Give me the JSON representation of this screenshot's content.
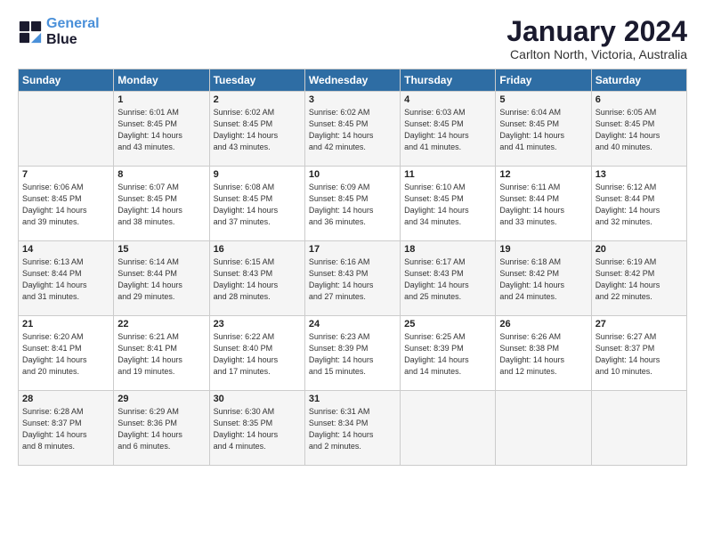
{
  "logo": {
    "line1": "General",
    "line2": "Blue"
  },
  "title": "January 2024",
  "subtitle": "Carlton North, Victoria, Australia",
  "days_header": [
    "Sunday",
    "Monday",
    "Tuesday",
    "Wednesday",
    "Thursday",
    "Friday",
    "Saturday"
  ],
  "weeks": [
    [
      {
        "day": "",
        "info": ""
      },
      {
        "day": "1",
        "info": "Sunrise: 6:01 AM\nSunset: 8:45 PM\nDaylight: 14 hours\nand 43 minutes."
      },
      {
        "day": "2",
        "info": "Sunrise: 6:02 AM\nSunset: 8:45 PM\nDaylight: 14 hours\nand 43 minutes."
      },
      {
        "day": "3",
        "info": "Sunrise: 6:02 AM\nSunset: 8:45 PM\nDaylight: 14 hours\nand 42 minutes."
      },
      {
        "day": "4",
        "info": "Sunrise: 6:03 AM\nSunset: 8:45 PM\nDaylight: 14 hours\nand 41 minutes."
      },
      {
        "day": "5",
        "info": "Sunrise: 6:04 AM\nSunset: 8:45 PM\nDaylight: 14 hours\nand 41 minutes."
      },
      {
        "day": "6",
        "info": "Sunrise: 6:05 AM\nSunset: 8:45 PM\nDaylight: 14 hours\nand 40 minutes."
      }
    ],
    [
      {
        "day": "7",
        "info": "Sunrise: 6:06 AM\nSunset: 8:45 PM\nDaylight: 14 hours\nand 39 minutes."
      },
      {
        "day": "8",
        "info": "Sunrise: 6:07 AM\nSunset: 8:45 PM\nDaylight: 14 hours\nand 38 minutes."
      },
      {
        "day": "9",
        "info": "Sunrise: 6:08 AM\nSunset: 8:45 PM\nDaylight: 14 hours\nand 37 minutes."
      },
      {
        "day": "10",
        "info": "Sunrise: 6:09 AM\nSunset: 8:45 PM\nDaylight: 14 hours\nand 36 minutes."
      },
      {
        "day": "11",
        "info": "Sunrise: 6:10 AM\nSunset: 8:45 PM\nDaylight: 14 hours\nand 34 minutes."
      },
      {
        "day": "12",
        "info": "Sunrise: 6:11 AM\nSunset: 8:44 PM\nDaylight: 14 hours\nand 33 minutes."
      },
      {
        "day": "13",
        "info": "Sunrise: 6:12 AM\nSunset: 8:44 PM\nDaylight: 14 hours\nand 32 minutes."
      }
    ],
    [
      {
        "day": "14",
        "info": "Sunrise: 6:13 AM\nSunset: 8:44 PM\nDaylight: 14 hours\nand 31 minutes."
      },
      {
        "day": "15",
        "info": "Sunrise: 6:14 AM\nSunset: 8:44 PM\nDaylight: 14 hours\nand 29 minutes."
      },
      {
        "day": "16",
        "info": "Sunrise: 6:15 AM\nSunset: 8:43 PM\nDaylight: 14 hours\nand 28 minutes."
      },
      {
        "day": "17",
        "info": "Sunrise: 6:16 AM\nSunset: 8:43 PM\nDaylight: 14 hours\nand 27 minutes."
      },
      {
        "day": "18",
        "info": "Sunrise: 6:17 AM\nSunset: 8:43 PM\nDaylight: 14 hours\nand 25 minutes."
      },
      {
        "day": "19",
        "info": "Sunrise: 6:18 AM\nSunset: 8:42 PM\nDaylight: 14 hours\nand 24 minutes."
      },
      {
        "day": "20",
        "info": "Sunrise: 6:19 AM\nSunset: 8:42 PM\nDaylight: 14 hours\nand 22 minutes."
      }
    ],
    [
      {
        "day": "21",
        "info": "Sunrise: 6:20 AM\nSunset: 8:41 PM\nDaylight: 14 hours\nand 20 minutes."
      },
      {
        "day": "22",
        "info": "Sunrise: 6:21 AM\nSunset: 8:41 PM\nDaylight: 14 hours\nand 19 minutes."
      },
      {
        "day": "23",
        "info": "Sunrise: 6:22 AM\nSunset: 8:40 PM\nDaylight: 14 hours\nand 17 minutes."
      },
      {
        "day": "24",
        "info": "Sunrise: 6:23 AM\nSunset: 8:39 PM\nDaylight: 14 hours\nand 15 minutes."
      },
      {
        "day": "25",
        "info": "Sunrise: 6:25 AM\nSunset: 8:39 PM\nDaylight: 14 hours\nand 14 minutes."
      },
      {
        "day": "26",
        "info": "Sunrise: 6:26 AM\nSunset: 8:38 PM\nDaylight: 14 hours\nand 12 minutes."
      },
      {
        "day": "27",
        "info": "Sunrise: 6:27 AM\nSunset: 8:37 PM\nDaylight: 14 hours\nand 10 minutes."
      }
    ],
    [
      {
        "day": "28",
        "info": "Sunrise: 6:28 AM\nSunset: 8:37 PM\nDaylight: 14 hours\nand 8 minutes."
      },
      {
        "day": "29",
        "info": "Sunrise: 6:29 AM\nSunset: 8:36 PM\nDaylight: 14 hours\nand 6 minutes."
      },
      {
        "day": "30",
        "info": "Sunrise: 6:30 AM\nSunset: 8:35 PM\nDaylight: 14 hours\nand 4 minutes."
      },
      {
        "day": "31",
        "info": "Sunrise: 6:31 AM\nSunset: 8:34 PM\nDaylight: 14 hours\nand 2 minutes."
      },
      {
        "day": "",
        "info": ""
      },
      {
        "day": "",
        "info": ""
      },
      {
        "day": "",
        "info": ""
      }
    ]
  ]
}
